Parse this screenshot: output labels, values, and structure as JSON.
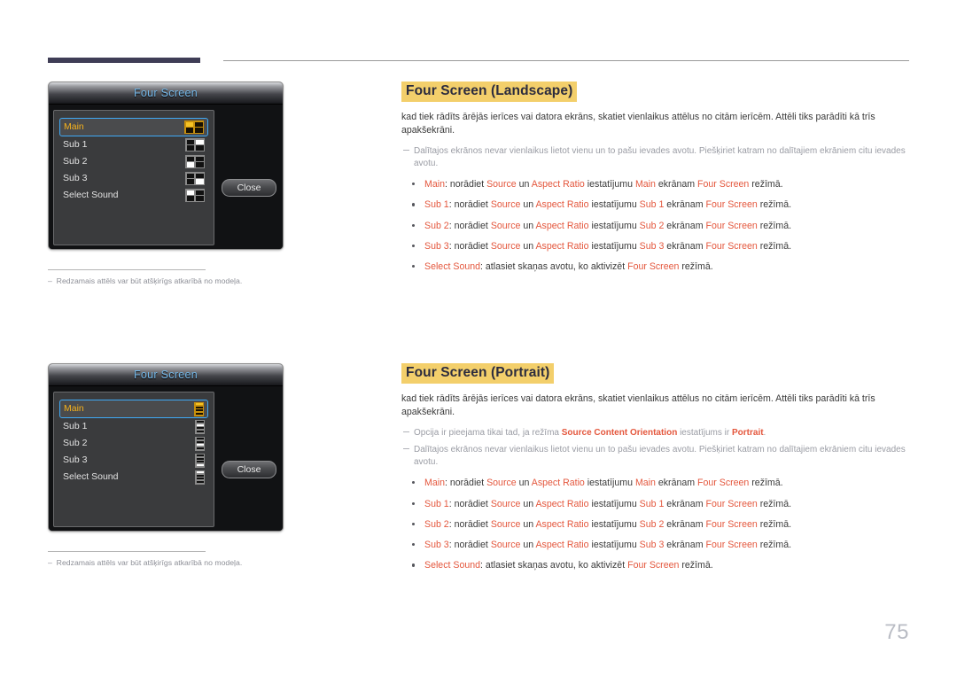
{
  "page": {
    "number": "75"
  },
  "osd": {
    "title": "Four Screen",
    "close_label": "Close",
    "rows": [
      {
        "label": "Main",
        "selected": true,
        "landscape_on": 0,
        "portrait_on": 0
      },
      {
        "label": "Sub 1",
        "selected": false,
        "landscape_on": 1,
        "portrait_on": 1
      },
      {
        "label": "Sub 2",
        "selected": false,
        "landscape_on": 2,
        "portrait_on": 2
      },
      {
        "label": "Sub 3",
        "selected": false,
        "landscape_on": 3,
        "portrait_on": 3
      },
      {
        "label": "Select Sound",
        "selected": false,
        "landscape_on": 0,
        "portrait_on": 0
      }
    ]
  },
  "figure_caption": "Redzamais attēls var būt atšķirīgs atkarībā no modeļa.",
  "sections": [
    {
      "heading": "Four Screen (Landscape)",
      "intro": "kad tiek rādīts ārējās ierīces vai datora ekrāns, skatiet vienlaikus attēlus no citām ierīcēm. Attēli tiks parādīti kā trīs apakšekrāni.",
      "notes": [
        {
          "parts": [
            {
              "t": "Dalītajos ekrānos nevar vienlaikus lietot vienu un to pašu ievades avotu. Piešķiriet katram no dalītajiem ekrāniem citu ievades avotu.",
              "kw": false
            }
          ]
        }
      ],
      "bullets": [
        {
          "parts": [
            {
              "t": "Main",
              "kw": true
            },
            {
              "t": ": norādiet ",
              "kw": false
            },
            {
              "t": "Source",
              "kw": true
            },
            {
              "t": " un ",
              "kw": false
            },
            {
              "t": "Aspect Ratio",
              "kw": true
            },
            {
              "t": " iestatījumu ",
              "kw": false
            },
            {
              "t": "Main",
              "kw": true
            },
            {
              "t": " ekrānam ",
              "kw": false
            },
            {
              "t": "Four Screen",
              "kw": true
            },
            {
              "t": " režīmā.",
              "kw": false
            }
          ]
        },
        {
          "parts": [
            {
              "t": "Sub 1",
              "kw": true
            },
            {
              "t": ": norādiet ",
              "kw": false
            },
            {
              "t": "Source",
              "kw": true
            },
            {
              "t": " un ",
              "kw": false
            },
            {
              "t": "Aspect Ratio",
              "kw": true
            },
            {
              "t": " iestatījumu ",
              "kw": false
            },
            {
              "t": "Sub 1",
              "kw": true
            },
            {
              "t": " ekrānam ",
              "kw": false
            },
            {
              "t": "Four Screen",
              "kw": true
            },
            {
              "t": " režīmā.",
              "kw": false
            }
          ]
        },
        {
          "parts": [
            {
              "t": "Sub 2",
              "kw": true
            },
            {
              "t": ": norādiet ",
              "kw": false
            },
            {
              "t": "Source",
              "kw": true
            },
            {
              "t": " un ",
              "kw": false
            },
            {
              "t": "Aspect Ratio",
              "kw": true
            },
            {
              "t": " iestatījumu ",
              "kw": false
            },
            {
              "t": "Sub 2",
              "kw": true
            },
            {
              "t": " ekrānam ",
              "kw": false
            },
            {
              "t": "Four Screen",
              "kw": true
            },
            {
              "t": " režīmā.",
              "kw": false
            }
          ]
        },
        {
          "parts": [
            {
              "t": "Sub 3",
              "kw": true
            },
            {
              "t": ": norādiet ",
              "kw": false
            },
            {
              "t": "Source",
              "kw": true
            },
            {
              "t": " un ",
              "kw": false
            },
            {
              "t": "Aspect Ratio",
              "kw": true
            },
            {
              "t": " iestatījumu ",
              "kw": false
            },
            {
              "t": "Sub 3",
              "kw": true
            },
            {
              "t": " ekrānam ",
              "kw": false
            },
            {
              "t": "Four Screen",
              "kw": true
            },
            {
              "t": " režīmā.",
              "kw": false
            }
          ]
        },
        {
          "parts": [
            {
              "t": "Select Sound",
              "kw": true
            },
            {
              "t": ": atlasiet skaņas avotu, ko aktivizēt ",
              "kw": false
            },
            {
              "t": "Four Screen",
              "kw": true
            },
            {
              "t": " režīmā.",
              "kw": false
            }
          ]
        }
      ]
    },
    {
      "heading": "Four Screen (Portrait)",
      "intro": "kad tiek rādīts ārējās ierīces vai datora ekrāns, skatiet vienlaikus attēlus no citām ierīcēm. Attēli tiks parādīti kā trīs apakšekrāni.",
      "notes": [
        {
          "parts": [
            {
              "t": "Opcija ir pieejama tikai tad, ja režīma ",
              "kw": false
            },
            {
              "t": "Source Content Orientation",
              "kw": true
            },
            {
              "t": " iestatījums ir ",
              "kw": false
            },
            {
              "t": "Portrait",
              "kw": true
            },
            {
              "t": ".",
              "kw": false
            }
          ]
        },
        {
          "parts": [
            {
              "t": "Dalītajos ekrānos nevar vienlaikus lietot vienu un to pašu ievades avotu. Piešķiriet katram no dalītajiem ekrāniem citu ievades avotu.",
              "kw": false
            }
          ]
        }
      ],
      "bullets": [
        {
          "parts": [
            {
              "t": "Main",
              "kw": true
            },
            {
              "t": ": norādiet ",
              "kw": false
            },
            {
              "t": "Source",
              "kw": true
            },
            {
              "t": " un ",
              "kw": false
            },
            {
              "t": "Aspect Ratio",
              "kw": true
            },
            {
              "t": " iestatījumu ",
              "kw": false
            },
            {
              "t": "Main",
              "kw": true
            },
            {
              "t": " ekrānam ",
              "kw": false
            },
            {
              "t": "Four Screen",
              "kw": true
            },
            {
              "t": " režīmā.",
              "kw": false
            }
          ]
        },
        {
          "parts": [
            {
              "t": "Sub 1",
              "kw": true
            },
            {
              "t": ": norādiet ",
              "kw": false
            },
            {
              "t": "Source",
              "kw": true
            },
            {
              "t": " un ",
              "kw": false
            },
            {
              "t": "Aspect Ratio",
              "kw": true
            },
            {
              "t": " iestatījumu ",
              "kw": false
            },
            {
              "t": "Sub 1",
              "kw": true
            },
            {
              "t": " ekrānam ",
              "kw": false
            },
            {
              "t": "Four Screen",
              "kw": true
            },
            {
              "t": " režīmā.",
              "kw": false
            }
          ]
        },
        {
          "parts": [
            {
              "t": "Sub 2",
              "kw": true
            },
            {
              "t": ": norādiet ",
              "kw": false
            },
            {
              "t": "Source",
              "kw": true
            },
            {
              "t": " un ",
              "kw": false
            },
            {
              "t": "Aspect Ratio",
              "kw": true
            },
            {
              "t": " iestatījumu ",
              "kw": false
            },
            {
              "t": "Sub 2",
              "kw": true
            },
            {
              "t": " ekrānam ",
              "kw": false
            },
            {
              "t": "Four Screen",
              "kw": true
            },
            {
              "t": " režīmā.",
              "kw": false
            }
          ]
        },
        {
          "parts": [
            {
              "t": "Sub 3",
              "kw": true
            },
            {
              "t": ": norādiet ",
              "kw": false
            },
            {
              "t": "Source",
              "kw": true
            },
            {
              "t": " un ",
              "kw": false
            },
            {
              "t": "Aspect Ratio",
              "kw": true
            },
            {
              "t": " iestatījumu ",
              "kw": false
            },
            {
              "t": "Sub 3",
              "kw": true
            },
            {
              "t": " ekrānam ",
              "kw": false
            },
            {
              "t": "Four Screen",
              "kw": true
            },
            {
              "t": " režīmā.",
              "kw": false
            }
          ]
        },
        {
          "parts": [
            {
              "t": "Select Sound",
              "kw": true
            },
            {
              "t": ": atlasiet skaņas avotu, ko aktivizēt ",
              "kw": false
            },
            {
              "t": "Four Screen",
              "kw": true
            },
            {
              "t": " režīmā.",
              "kw": false
            }
          ]
        }
      ]
    }
  ],
  "colors": {
    "heading_highlight": "#f3cf6b",
    "keyword": "#e4573d",
    "osd_title": "#74b7e8",
    "osd_selected_label": "#f5b21c",
    "rule_dark": "#3f3d56"
  }
}
